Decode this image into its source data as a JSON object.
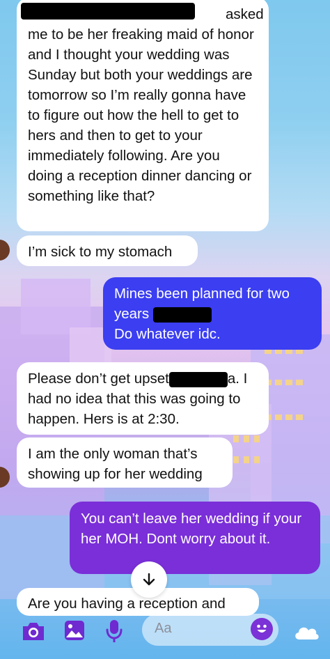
{
  "thread": {
    "messages": [
      {
        "id": "m1",
        "type": "received",
        "text": "asked\nme to be her freaking maid of honor and I thought your wedding was Sunday but both your weddings are tomorrow so I’m really gonna have to figure out how the hell to get to hers and then to get to your immediately following. Are you doing a reception dinner dancing or something like that?"
      },
      {
        "id": "m2",
        "type": "received",
        "text": "I’m sick to my stomach"
      },
      {
        "id": "m3",
        "type": "sent",
        "line1": "Mines been planned for two",
        "line2": "years",
        "line3": "Do whatever idc."
      },
      {
        "id": "m4",
        "type": "received",
        "line1a": "Please don’t get upset",
        "line1b": "a. I",
        "rest": "had no idea that this was going to happen. Hers is at 2:30."
      },
      {
        "id": "m5",
        "type": "received",
        "text": "I am the only woman that’s showing up for her wedding"
      },
      {
        "id": "m6",
        "type": "sent",
        "text": "You can’t leave her wedding if your her MOH. Dont worry about it."
      },
      {
        "id": "m7",
        "type": "received",
        "text": "Are you having a reception and"
      }
    ]
  },
  "composer": {
    "placeholder": "Aa"
  },
  "icons": {
    "camera": "camera-icon",
    "gallery": "image-icon",
    "mic": "microphone-icon",
    "emoji": "smiley-icon",
    "weather": "cloud-icon",
    "scroll": "arrow-down-icon"
  },
  "colors": {
    "sent_bubble": "#3b3ef1",
    "sent_bubble_alt": "#7a2fd8",
    "received_bubble": "#ffffff",
    "accent": "#7b32d6"
  }
}
